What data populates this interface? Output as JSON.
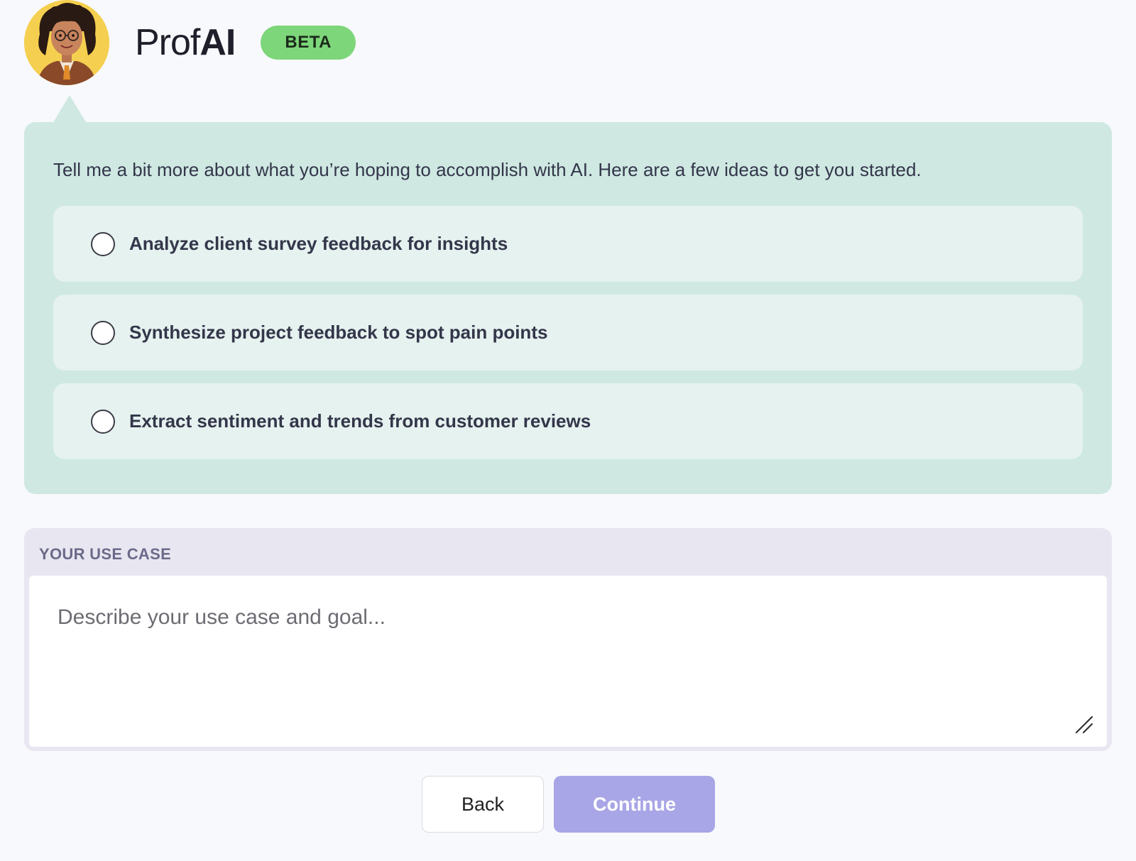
{
  "header": {
    "brand_prefix": "Prof",
    "brand_suffix": "AI",
    "badge": "BETA",
    "avatar_icon": "professor-avatar"
  },
  "bubble": {
    "prompt": "Tell me a bit more about what you’re hoping to accomplish with AI. Here are a few ideas to get you started.",
    "options": [
      {
        "label": "Analyze client survey feedback for insights",
        "selected": false
      },
      {
        "label": "Synthesize project feedback to spot pain points",
        "selected": false
      },
      {
        "label": "Extract sentiment and trends from customer reviews",
        "selected": false
      }
    ]
  },
  "usecase": {
    "label": "YOUR USE CASE",
    "value": "",
    "placeholder": "Describe your use case and goal..."
  },
  "actions": {
    "back_label": "Back",
    "continue_label": "Continue"
  },
  "colors": {
    "bubble_bg": "#cfe8e2",
    "option_bg": "#e5f2ef",
    "badge_bg": "#7ed67a",
    "continue_bg": "#a8a6e6",
    "usecase_bg": "#e8e7f1"
  }
}
